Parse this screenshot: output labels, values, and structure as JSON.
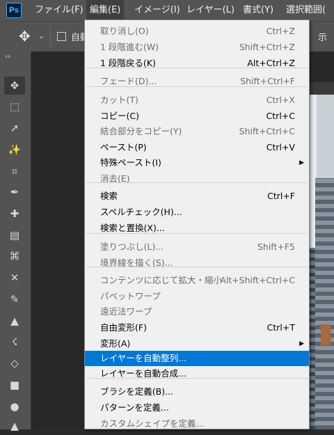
{
  "menubar": {
    "logo": "Ps",
    "items": [
      "ファイル(F)",
      "編集(E)",
      "イメージ(I)",
      "レイヤー(L)",
      "書式(Y)",
      "選択範囲("
    ]
  },
  "options": {
    "auto_label": "自動",
    "right_label": "示"
  },
  "toolbar": {
    "collapse": "››",
    "tools": [
      {
        "name": "move-tool",
        "glyph": "✥"
      },
      {
        "name": "marquee-tool",
        "glyph": "⬚"
      },
      {
        "name": "lasso-tool",
        "glyph": "➚"
      },
      {
        "name": "magic-wand-tool",
        "glyph": "✨"
      },
      {
        "name": "crop-tool",
        "glyph": "⌗"
      },
      {
        "name": "eyedropper-tool",
        "glyph": "✒"
      },
      {
        "name": "spot-heal-tool",
        "glyph": "✚"
      },
      {
        "name": "bandage-tool",
        "glyph": "▤"
      },
      {
        "name": "content-aware-tool",
        "glyph": "⌘"
      },
      {
        "name": "content-move-tool",
        "glyph": "✕"
      },
      {
        "name": "brush-tool",
        "glyph": "✎"
      },
      {
        "name": "stamp-tool",
        "glyph": "▲"
      },
      {
        "name": "history-brush-tool",
        "glyph": "☇"
      },
      {
        "name": "eraser-tool",
        "glyph": "◇"
      },
      {
        "name": "gradient-tool",
        "glyph": "■"
      },
      {
        "name": "blur-tool",
        "glyph": "●"
      },
      {
        "name": "dodge-tool",
        "glyph": "▲"
      }
    ]
  },
  "edit_menu": {
    "items": [
      {
        "label": "取り消し(O)",
        "shortcut": "Ctrl+Z",
        "disabled": true
      },
      {
        "label": "1 段階進む(W)",
        "shortcut": "Shift+Ctrl+Z",
        "disabled": true
      },
      {
        "label": "1 段階戻る(K)",
        "shortcut": "Alt+Ctrl+Z",
        "disabled": false
      },
      {
        "label": "フェード(D)...",
        "shortcut": "Shift+Ctrl+F",
        "disabled": true
      },
      {
        "label": "カット(T)",
        "shortcut": "Ctrl+X",
        "disabled": true
      },
      {
        "label": "コピー(C)",
        "shortcut": "Ctrl+C",
        "disabled": false
      },
      {
        "label": "結合部分をコピー(Y)",
        "shortcut": "Shift+Ctrl+C",
        "disabled": true
      },
      {
        "label": "ペースト(P)",
        "shortcut": "Ctrl+V",
        "disabled": false
      },
      {
        "label": "特殊ペースト(I)",
        "shortcut": "",
        "disabled": false,
        "submenu": true
      },
      {
        "label": "消去(E)",
        "shortcut": "",
        "disabled": true
      },
      {
        "label": "検索",
        "shortcut": "Ctrl+F",
        "disabled": false
      },
      {
        "label": "スペルチェック(H)...",
        "shortcut": "",
        "disabled": false
      },
      {
        "label": "検索と置換(X)...",
        "shortcut": "",
        "disabled": false
      },
      {
        "label": "塗りつぶし(L)...",
        "shortcut": "Shift+F5",
        "disabled": true
      },
      {
        "label": "境界線を描く(S)...",
        "shortcut": "",
        "disabled": true
      },
      {
        "label": "コンテンツに応じて拡大・縮小",
        "shortcut": "Alt+Shift+Ctrl+C",
        "disabled": true
      },
      {
        "label": "パペットワープ",
        "shortcut": "",
        "disabled": true
      },
      {
        "label": "遠近法ワープ",
        "shortcut": "",
        "disabled": true
      },
      {
        "label": "自由変形(F)",
        "shortcut": "Ctrl+T",
        "disabled": false
      },
      {
        "label": "変形(A)",
        "shortcut": "",
        "disabled": false,
        "submenu": true
      },
      {
        "label": "レイヤーを自動整列...",
        "shortcut": "",
        "disabled": false,
        "highlighted": true
      },
      {
        "label": "レイヤーを自動合成...",
        "shortcut": "",
        "disabled": false
      },
      {
        "label": "ブラシを定義(B)...",
        "shortcut": "",
        "disabled": false
      },
      {
        "label": "パターンを定義...",
        "shortcut": "",
        "disabled": false
      },
      {
        "label": "カスタムシェイプを定義...",
        "shortcut": "",
        "disabled": true
      }
    ]
  }
}
